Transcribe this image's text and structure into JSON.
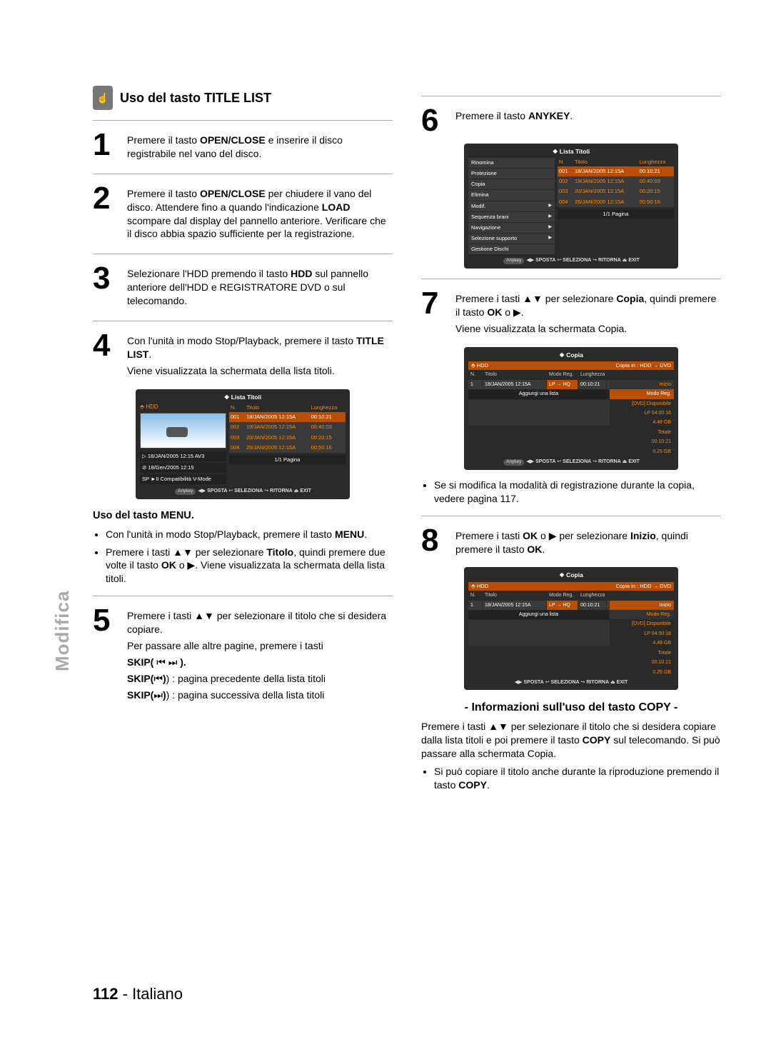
{
  "sidebar": {
    "label": "Modifica"
  },
  "footer": {
    "page": "112",
    "sep": " - ",
    "lang": "Italiano"
  },
  "icons": {
    "hand": "☝"
  },
  "section": {
    "title": "Uso del tasto TITLE LIST"
  },
  "steps": {
    "s1": {
      "n": "1",
      "t1a": "Premere il tasto ",
      "t1b": "OPEN/CLOSE",
      "t1c": " e inserire il disco registrabile nel vano del disco."
    },
    "s2": {
      "n": "2",
      "a": "Premere il tasto ",
      "b": "OPEN/CLOSE",
      "c": " per chiudere il vano del disco. Attendere fino a quando l'indicazione ",
      "d": "LOAD",
      "e": " scompare dal display del pannello anteriore. Verificare che il disco abbia spazio sufficiente per la registrazione."
    },
    "s3": {
      "n": "3",
      "a": "Selezionare l'HDD premendo il tasto ",
      "b": "HDD",
      "c": " sul pannello anteriore dell'HDD e REGISTRATORE DVD o sul telecomando."
    },
    "s4": {
      "n": "4",
      "a": "Con l'unità in modo Stop/Playback, premere il tasto ",
      "b": "TITLE LIST",
      "c": ".",
      "after": "Viene visualizzata la schermata della lista titoli."
    },
    "menu": {
      "title": "Uso del tasto MENU.",
      "b1a": "Con l'unità in modo Stop/Playback, premere il tasto ",
      "b1b": "MENU",
      "b1c": ".",
      "b2a": "Premere i tasti ▲▼ per selezionare ",
      "b2b": "Titolo",
      "b2c": ", quindi premere due volte il tasto ",
      "b2d": "OK",
      "b2e": " o ▶. Viene visualizzata la schermata della lista titoli."
    },
    "s5": {
      "n": "5",
      "a": "Premere i tasti ▲▼ per selezionare il titolo che si desidera copiare.",
      "b": "Per passare alle altre pagine, premere i tasti",
      "c1": "SKIP( ",
      "c2": " ).",
      "d1": "SKIP(",
      "d2": ") : pagina precedente della lista titoli",
      "e1": "SKIP(",
      "e2": ") : pagina successiva della lista titoli",
      "icon_prev": "⏮",
      "icon_next": "⏭",
      "icon_both": "⏮ ⏭"
    },
    "s6": {
      "n": "6",
      "a": "Premere il tasto ",
      "b": "ANYKEY",
      "c": "."
    },
    "s7": {
      "n": "7",
      "a": "Premere i tasti ▲▼ per selezionare ",
      "b": "Copia",
      "c": ", quindi premere il tasto ",
      "d": "OK",
      "e": " o ▶.",
      "after": "Viene visualizzata la schermata Copia."
    },
    "note7": "Se si modifica la modalità di registrazione durante la copia, vedere pagina 117.",
    "s8": {
      "n": "8",
      "a": "Premere i tasti ",
      "b": "OK",
      "c": " o ▶ per selezionare ",
      "d": "Inizio",
      "e": ", quindi premere il tasto ",
      "f": "OK",
      "g": "."
    },
    "copyinfo": {
      "title": "- Informazioni sull'uso del tasto COPY -",
      "p1a": "Premere i tasti ▲▼ per selezionare il titolo che si desidera copiare dalla lista titoli e poi premere il tasto ",
      "p1b": "COPY",
      "p1c": " sul telecomando. Si può passare alla schermata Copia.",
      "b1a": "Si può copiare il titolo anche durante la riproduzione premendo il tasto ",
      "b1b": "COPY",
      "b1c": "."
    }
  },
  "ui": {
    "common_ctrl": {
      "anykey": "Anykey",
      "sposta": "SPOSTA",
      "seleziona": "SELEZIONA",
      "ritorna": "RITORNA",
      "exit": "EXIT",
      "arrows": "◀▶",
      "ret": "↩",
      "x": "⏏"
    },
    "titlelist": {
      "head": "❖  Lista Titoli",
      "device": "⬘ HDD",
      "cols": {
        "n": "N.",
        "titolo": "Titolo",
        "len": "Lunghezza"
      },
      "rows": [
        {
          "n": "001",
          "t": "18/JAN/2005 12:15A",
          "l": "00:10:21"
        },
        {
          "n": "002",
          "t": "19/JAN/2005 12:15A",
          "l": "00:40:03"
        },
        {
          "n": "003",
          "t": "20/JAN/2005 12:15A",
          "l": "00:20:15"
        },
        {
          "n": "004",
          "t": "25/JAN/2005 12:15A",
          "l": "00:50:16"
        }
      ],
      "meta1": "▷ 18/JAN/2005 12:15 AV3",
      "meta2": "⊘ 18/Gen/2005 12:15",
      "meta3": "SP ►II Compatibilità V-Mode",
      "pagination": "1/1 Pagina"
    },
    "contextmenu": {
      "head": "❖  Lista Titoli",
      "items": [
        "Rinomina",
        "Protezione",
        "Copia",
        "Elimina",
        "Modif.",
        "Sequenza brani",
        "Navigazione",
        "Selezione supporto",
        "Gestione Dischi"
      ],
      "arrow_items": [
        4,
        5,
        6,
        7
      ],
      "cols": {
        "n": "N.",
        "titolo": "Titolo",
        "len": "Lunghezza"
      },
      "rows": [
        {
          "n": "001",
          "t": "18/JAN/2005 12:15A",
          "l": "00:10:21"
        },
        {
          "n": "002",
          "t": "19/JAN/2005 12:15A",
          "l": "00:40:03"
        },
        {
          "n": "003",
          "t": "20/JAN/2005 12:15A",
          "l": "00:20:15"
        },
        {
          "n": "004",
          "t": "25/JAN/2005 12:15A",
          "l": "00:50:16"
        }
      ],
      "pagination": "1/1 Pagina"
    },
    "copia": {
      "head": "❖  Copia",
      "device": "⬘ HDD",
      "strip": "Copia in : HDD → DVD",
      "cols": {
        "n": "N.",
        "titolo": "Titolo",
        "mode": "Modo Reg.",
        "len": "Lunghezza"
      },
      "row": {
        "n": "1",
        "t": "18/JAN/2005 12:15A",
        "m": "LP → HQ",
        "l": "00:10:21"
      },
      "add": "Aggiungi una lista",
      "side": {
        "inizio": "Inizio",
        "modo": "Modo Reg.",
        "disp": "[DVD] Disponibile",
        "lp": "LP   04:00:16",
        "gb": "4.48 GB",
        "tot": "Totale",
        "tt": "00:10:21",
        "tg": "0.25 GB"
      }
    }
  }
}
